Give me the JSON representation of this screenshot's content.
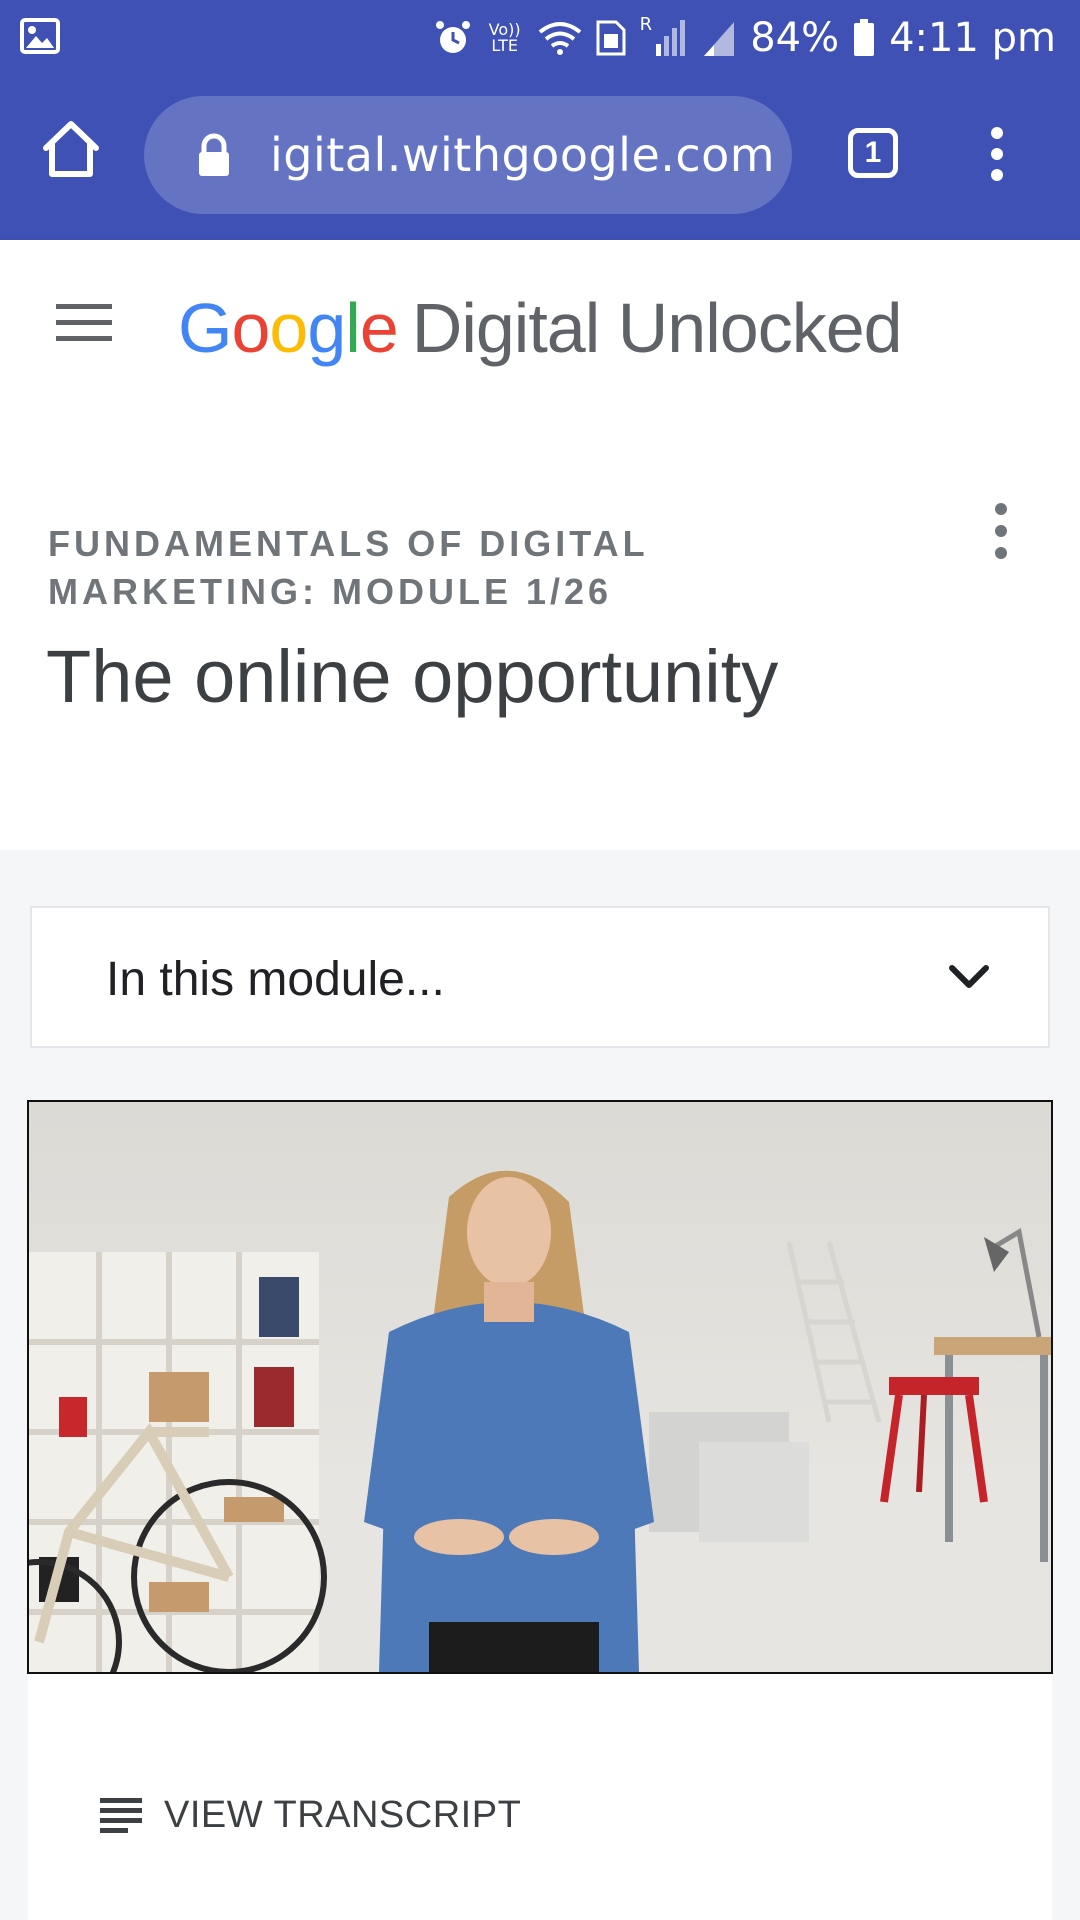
{
  "status_bar": {
    "battery": "84%",
    "time": "4:11 pm",
    "network_label": "Vo)) LTE",
    "sim_label": "R"
  },
  "browser": {
    "url": "igital.withgoogle.com",
    "tab_count": "1"
  },
  "header": {
    "logo_google_letters": [
      "G",
      "o",
      "o",
      "g",
      "l",
      "e"
    ],
    "logo_rest": "Digital Unlocked"
  },
  "page": {
    "module_label_line1": "FUNDAMENTALS OF DIGITAL",
    "module_label_line2": "MARKETING: MODULE 1/26",
    "title": "The online opportunity"
  },
  "module_dropdown": {
    "label": "In this module..."
  },
  "transcript": {
    "label": "VIEW TRANSCRIPT"
  },
  "colors": {
    "browser_bar": "#3f51b5",
    "url_pill": "#6573c3",
    "google_blue": "#4285f4",
    "google_red": "#ea4335",
    "google_yellow": "#fbbc05",
    "google_green": "#34a853"
  }
}
